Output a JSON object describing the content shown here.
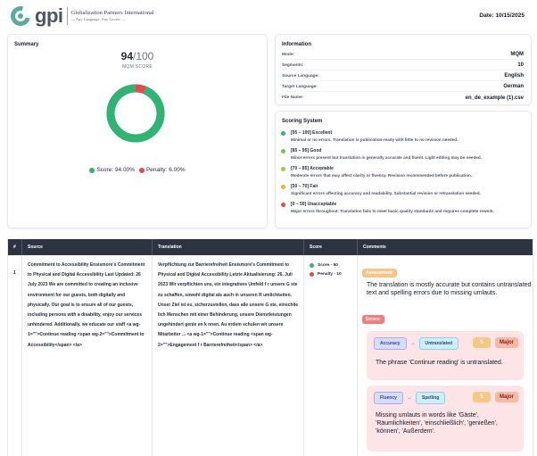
{
  "header": {
    "logo_text": "gpi",
    "company_name": "Globalization Partners International",
    "company_tag": "— Any Language. Any Locale. —",
    "date": "Date: 10/15/2025"
  },
  "summary": {
    "title": "Summary",
    "score": "94",
    "score_max": "/100",
    "score_label": "MQM SCORE",
    "score_fraction": 0.94,
    "score_legend": "Score: 94.00%",
    "penalty_legend": "Penalty: 6.00%",
    "colors": {
      "score": "#2bb673",
      "penalty": "#e5484d"
    }
  },
  "information": {
    "title": "Information",
    "rows": [
      {
        "key": "Mode:",
        "value": "MQM"
      },
      {
        "key": "Segments:",
        "value": "10"
      },
      {
        "key": "Source Language:",
        "value": "English"
      },
      {
        "key": "Target Language:",
        "value": "German"
      },
      {
        "key": "File Name:",
        "value": "en_de_example (1).csv"
      }
    ]
  },
  "scoring": {
    "title": "Scoring System",
    "tiers": [
      {
        "title": "[95 – 100] Excellent",
        "desc": "Minimal or no errors. Translation is publication-ready with little to no revision needed.",
        "color": "#2bb673"
      },
      {
        "title": "[85 – 95] Good",
        "desc": "Minor errors present but translation is generally accurate and fluent. Light editing may be needed.",
        "color": "#7cc242"
      },
      {
        "title": "[70 – 85] Acceptable",
        "desc": "Moderate errors that may affect clarity or fluency. Revision recommended before publication.",
        "color": "#a3c93a"
      },
      {
        "title": "[50 – 70] Fair",
        "desc": "Significant errors affecting accuracy and readability. Substantial revision or retranslation needed.",
        "color": "#f5b323"
      },
      {
        "title": "[0 – 50] Unacceptable",
        "desc": "Major errors throughout. Translation fails to meet basic quality standards and requires complete rework.",
        "color": "#e5484d"
      }
    ]
  },
  "table": {
    "headers": {
      "num": "#",
      "source": "Source",
      "translation": "Translation",
      "score": "Score",
      "comments": "Comments"
    },
    "row": {
      "num": "1",
      "source": "Commitment to Accessibility Ensismore's Commitment to Physical and Digital Accessibility Last Updated: 26 July 2023 We are committed to creating an inclusive environment for our guests, both digitally and physically. Our goal is to ensure all of our guests, including persons with a disability, enjoy our services unhindered. Additionally, we educate our staff <a wg-1=\"\">Continue reading <span wg-2=\"\">Commitment to Accessibility</span> </a>",
      "translation": "Verpflichtung zur Barrierefreiheit Ensismore's Commitment to Physical and Digital Accessibility Letzte Aktualisierung: 26. Juli 2023 Wir verpflichten uns, ein integratives Umfeld f r unsere G ste zu schaffen, sowohl digital als auch in unseren R umlichkeiten. Unser Ziel ist es, sicherzustellen, dass alle unsere G ste, einschlie lich Menschen mit einer Behinderung, unsere Dienstleistungen ungehindert genie en k nnen. Au erdem schulen wir unsere Mitarbeiter ... <a wg-1=\"\">Continue reading <span wg-2=\"\">Engagement f r Barrierefreiheit</span> </a>",
      "score_items": [
        {
          "label": "Score - 90",
          "color": "#2bb673"
        },
        {
          "label": "Penalty - 10",
          "color": "#e5484d"
        }
      ],
      "assessment_label": "Assessment:",
      "assessment_text": "The translation is mostly accurate but contains untranslated text and spelling errors due to missing umlauts.",
      "errors_label": "Errors:",
      "errors": [
        {
          "category": "Accuracy",
          "subcategory": "Untranslated",
          "severity_num": "5",
          "severity": "Major",
          "text": "The phrase 'Continue reading' is untranslated."
        },
        {
          "category": "Fluency",
          "subcategory": "Spelling",
          "severity_num": "5",
          "severity": "Major",
          "text": "Missing umlauts in words like 'Gäste', 'Räumlichkeiten', 'einschließlich', 'genießen', 'können', 'Außerdem'."
        }
      ]
    }
  }
}
